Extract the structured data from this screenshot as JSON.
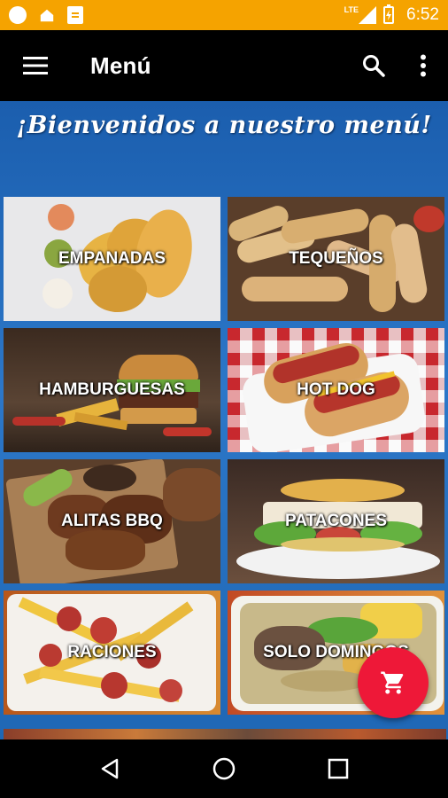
{
  "status_bar": {
    "network": "LTE",
    "time": "6:52",
    "color": "#f5a300"
  },
  "app_bar": {
    "title": "Menú",
    "icons": [
      "menu-icon",
      "search-icon",
      "more-vert-icon"
    ]
  },
  "welcome": {
    "text": "¡Bienvenidos a nuestro menú!"
  },
  "categories": [
    {
      "label": "EMPANADAS"
    },
    {
      "label": "TEQUEÑOS"
    },
    {
      "label": "HAMBURGUESAS"
    },
    {
      "label": "HOT DOG"
    },
    {
      "label": "ALITAS BBQ"
    },
    {
      "label": "PATACONES"
    },
    {
      "label": "RACIONES"
    },
    {
      "label": "SOLO DOMINGOS"
    }
  ],
  "fab": {
    "icon": "cart-icon",
    "color": "#ee1838"
  },
  "nav_bar": {
    "icons": [
      "back-icon",
      "home-icon",
      "recents-icon"
    ]
  },
  "colors": {
    "content_background": "#2c77c8",
    "app_bar": "#000000"
  }
}
